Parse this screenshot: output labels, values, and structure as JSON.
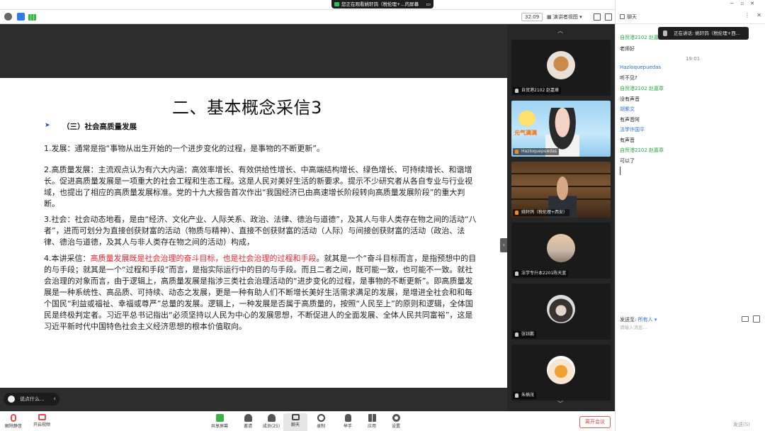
{
  "top": {
    "share_banner": "您正在观看姚轩鸽（税伦理+...的屏幕",
    "timer": "32:09",
    "view_label": "演讲者视图"
  },
  "slide": {
    "title": "二、基本概念采信3",
    "bullet": "➤",
    "heading": "（三）社会高质量发展",
    "p1": "1.发展：通常是指“事物从出生开始的一个进步变化的过程，是事物的不断更新”。",
    "p2": "2.高质量发展：主流观点认为有六大内涵：高效率增长、有效供给性增长、中高端结构增长、绿色增长、可持续增长、和谐增长。促进高质量发展是一项重大的社会工程和生态工程。这是人民对美好生活的新要求。提示不少研究者从各自专业与行业视域，也提出了相应的高质量发展标准。党的十九大报告首次作出“我国经济已由高速增长阶段转向高质量发展阶段”的重大判断。",
    "p3": "3.社会：社会动态地看，是由“经济、文化产业、人际关系、政治、法律、德治与道德”，及其人与非人类存在物之间的活动“八者”，进而可划分为直接创获财富的活动（物质与精神）、直接不创获财富的活动（人际）与间接创获财富的活动（政治、法律、德治与道德，及其人与非人类存在物之间的活动）构成，",
    "p4_a": "4.本讲采信：",
    "p4_highlight": "高质量发展既是社会治理的奋斗目标，也是社会治理的过程和手段",
    "p4_b": "。就其是一个“奋斗目标而言，是指预想中的目的与手段；就其是一个“过程和手段”而言，是指实际运行中的目的与手段。而且二者之间，既可能一致，也可能不一致。就社会治理的对象而言，由于逻辑上，高质量发展是指涉三类社会治理活动的“进步变化的过程，是事物的不断更新”。即高质量发展是一种系统性、高品质、可持续、动态之发展，更是一种有助人们不断增长美好生活需求满足的发展，是增进全社会和和每个国民“利益或福祉、幸福或尊严”总量的发展。逻辑上，一种发展是否属于高质量的，按照“人民至上”的原则和逻辑，全体国民是终极判定者。习近平总书记指出“必须坚持以人民为中心的发展思想，不断促进人的全面发展、全体人民共同富裕”，这是习近平新时代中国特色社会主义经济思想的根本价值取向。"
  },
  "chat_bubble": "说点什么...",
  "gallery": {
    "tiles": [
      {
        "name": "自贸港2102 赵嘉章"
      },
      {
        "name": "Hazloquepuedas",
        "sticker": "元气满满"
      },
      {
        "name": "姚轩鸽（税伦理+西安）"
      },
      {
        "name": "法学专升本2201陈天蓝"
      },
      {
        "name": "张钰鹏"
      },
      {
        "name": "朱楠茂"
      }
    ]
  },
  "controls": {
    "mute": "解除静音",
    "video": "开启视频",
    "share": "共享屏幕",
    "invite": "邀请",
    "members": "成员(25)",
    "chat": "聊天",
    "record": "录制",
    "raise_hand": "举手",
    "apps": "应用",
    "settings": "设置",
    "leave": "离开会议"
  },
  "chat": {
    "title": "聊天",
    "speaker_pill": "正在讲话: 姚轩鸽（税伦理+西...",
    "messages": [
      {
        "sender": "自贸港2102 赵嘉章",
        "kind": "green"
      },
      {
        "text": "老师好"
      },
      {
        "time": "19:01"
      },
      {
        "sender": "Hazloquepuedas",
        "kind": "blue"
      },
      {
        "text": "听不见?"
      },
      {
        "sender": "自贸港2102 赵嘉章",
        "kind": "green"
      },
      {
        "text": "没有声音"
      },
      {
        "sender": "胡紫文",
        "kind": "blue"
      },
      {
        "text": "有声音阿"
      },
      {
        "sender": "法学许国平",
        "kind": "blue"
      },
      {
        "text": "有声音"
      },
      {
        "sender": "自贸港2102 赵嘉章",
        "kind": "green"
      },
      {
        "text": "可以了"
      }
    ],
    "send_to_label": "发送至:",
    "send_to_value": "所有人 ▾",
    "input_placeholder": "请输入消息...",
    "send_button": "发送(S)"
  }
}
